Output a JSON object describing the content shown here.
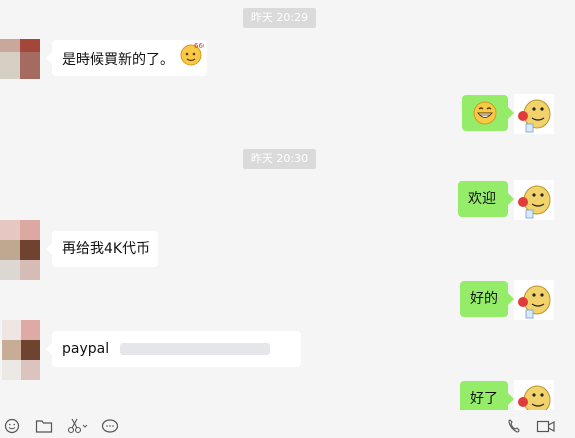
{
  "timestamps": [
    "昨天 20:29",
    "昨天 20:30"
  ],
  "messages": [
    {
      "dir": "in",
      "text": "是時候買新的了。",
      "emoji": "666-face-emoji"
    },
    {
      "dir": "out",
      "text": "",
      "emoji": "grin-emoji"
    },
    {
      "dir": "out",
      "text": "欢迎"
    },
    {
      "dir": "in",
      "text": "再给我4K代币"
    },
    {
      "dir": "out",
      "text": "好的"
    },
    {
      "dir": "in",
      "text": "paypal",
      "redacted": true
    },
    {
      "dir": "out",
      "text": "好了"
    }
  ],
  "emoji_badge": "666",
  "toolbar": {
    "left_icons": [
      "emoji-icon",
      "folder-icon",
      "scissors-icon",
      "chat-bubble-icon"
    ],
    "right_icons": [
      "phone-icon",
      "video-icon"
    ]
  },
  "colors": {
    "background": "#f5f5f5",
    "incoming_bubble": "#ffffff",
    "outgoing_bubble": "#95ec69",
    "timestamp_bg": "#dadada"
  }
}
